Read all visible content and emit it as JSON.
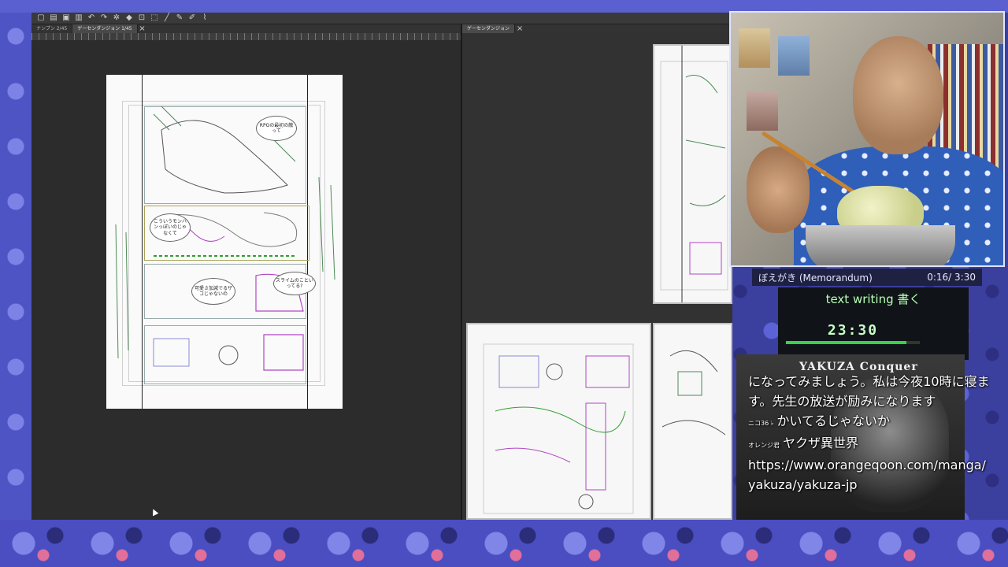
{
  "app": {
    "tabs_left": [
      "ナンプン 2/45",
      "ゲーセンダンジョン 1/45"
    ],
    "tabs_right": [
      "ゲーセンダンジョン"
    ]
  },
  "manga_page": {
    "bubbles": [
      "RPGの最初の敵って",
      "こういうモンハンっぽいのじゃなくて",
      "可愛さ加減でるザコじゃないの",
      "スライムのこといってる?"
    ]
  },
  "music": {
    "title": "ぼえがき (Memorandum)",
    "time": "0:16/ 3:30"
  },
  "timer": {
    "label": "text writing 書く",
    "value": "23:30",
    "progress": 0.9
  },
  "chat_backdrop": {
    "title": "YAKUZA Conquer"
  },
  "chat": {
    "lines": [
      {
        "user": "",
        "text": "になってみましょう。私は今夜10時に寝ます。先生の放送が励みになります"
      },
      {
        "user": "ニコ36 ♭",
        "text": "かいてるじゃないか"
      },
      {
        "user": "オレンジ君",
        "text": "ヤクザ異世界"
      },
      {
        "user": "",
        "text": "https://www.orangeqoon.com/manga/yakuza/yakuza-jp"
      }
    ]
  }
}
